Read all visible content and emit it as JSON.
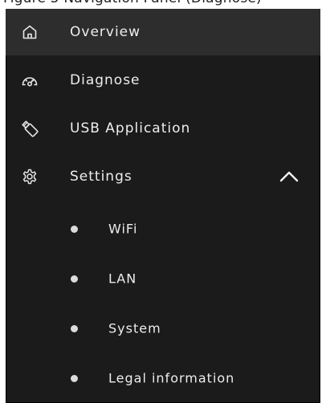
{
  "caption": {
    "text": "Figure 5   Navigation Panel (Diagnose)"
  },
  "menu": {
    "items": [
      {
        "label": "Overview",
        "icon": "home-icon",
        "active": true
      },
      {
        "label": "Diagnose",
        "icon": "gauge-icon",
        "active": false
      },
      {
        "label": "USB Application",
        "icon": "usb-icon",
        "active": false
      },
      {
        "label": "Settings",
        "icon": "gear-icon",
        "active": false,
        "expanded": true
      }
    ],
    "settings_subitems": [
      {
        "label": "WiFi"
      },
      {
        "label": "LAN"
      },
      {
        "label": "System"
      },
      {
        "label": "Legal information"
      }
    ]
  },
  "colors": {
    "panel_background": "#1b1b1b",
    "active_background": "#2d2d2d",
    "text": "#ededed",
    "bullet": "#dcdcdc"
  }
}
